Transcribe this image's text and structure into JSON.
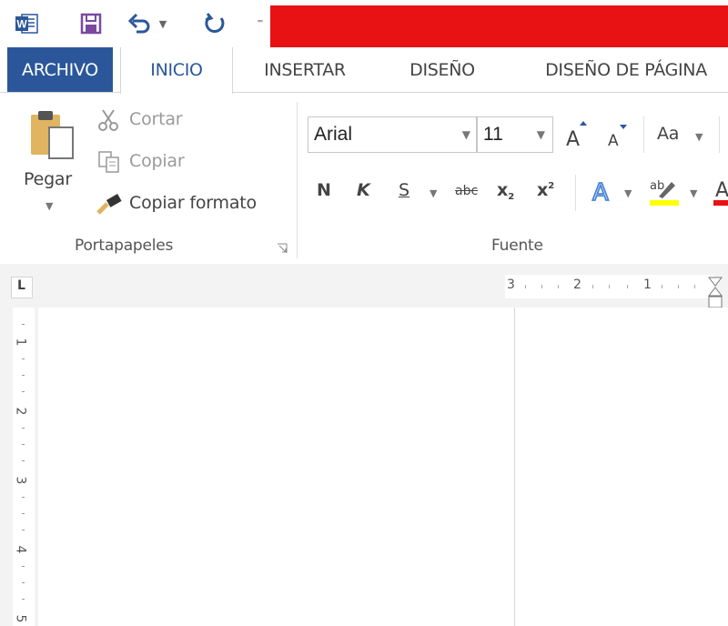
{
  "quick_access": {
    "icons": [
      "word-icon",
      "save-icon",
      "undo-icon",
      "undo-dropdown-icon",
      "redo-icon",
      "customize-icon"
    ],
    "title_redacted_color": "#e81113"
  },
  "tabs": {
    "archivo": "ARCHIVO",
    "inicio": "INICIO",
    "insertar": "INSERTAR",
    "diseno": "DISEÑO",
    "diseno_pagina": "DISEÑO DE PÁGINA",
    "active": "INICIO",
    "accent_color": "#2b579a"
  },
  "clipboard": {
    "paste": "Pegar",
    "cut": "Cortar",
    "copy": "Copiar",
    "format_painter": "Copiar formato",
    "group_label": "Portapapeles"
  },
  "font": {
    "font_name": "Arial",
    "font_size": "11",
    "change_case": "Aa",
    "bold": "N",
    "italic": "K",
    "underline": "S",
    "strikethrough": "abc",
    "subscript": "x",
    "superscript": "x",
    "group_label": "Fuente",
    "highlight_color": "#ffff00",
    "font_color": "#e81113"
  },
  "ruler": {
    "horizontal_numbers": [
      "3",
      "2",
      "1"
    ],
    "vertical_numbers": [
      "1",
      "2",
      "3",
      "4",
      "5"
    ],
    "tab_selector": "L"
  }
}
